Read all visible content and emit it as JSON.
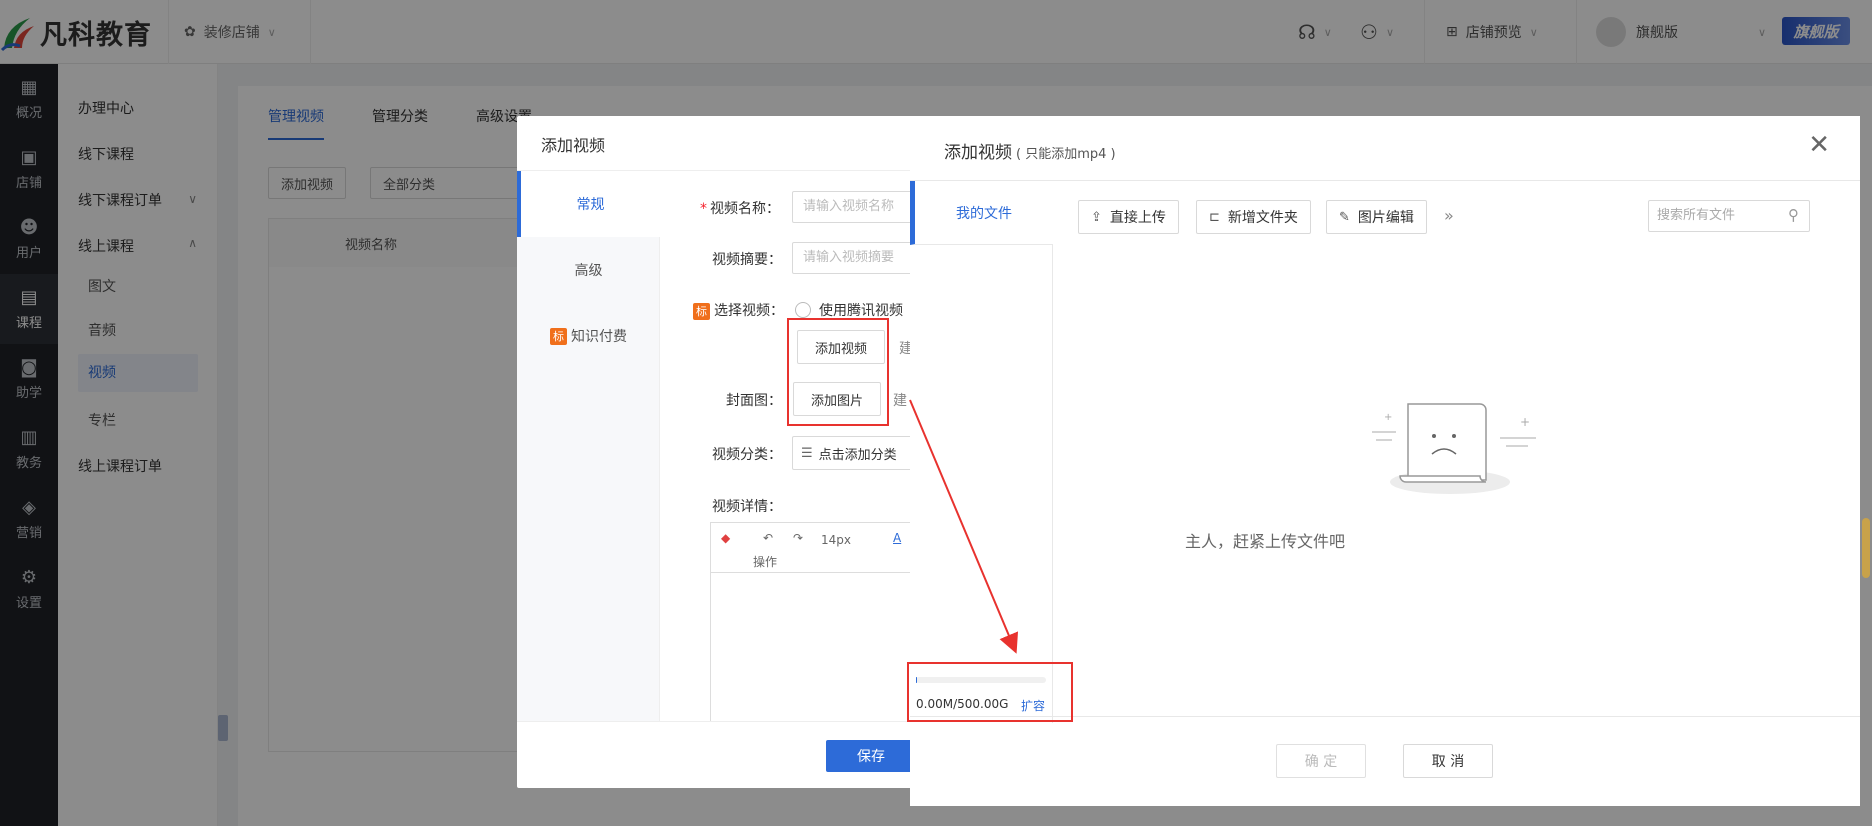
{
  "brand": {
    "name": "凡科教育",
    "accent": "#2d6bd8"
  },
  "header": {
    "shop_switch": "装修店铺",
    "preview": "店铺预览",
    "account": "旗舰版",
    "vip": "旗舰版"
  },
  "icon_nav": [
    {
      "label": "概况",
      "icon": "chart-icon"
    },
    {
      "label": "店铺",
      "icon": "store-icon"
    },
    {
      "label": "用户",
      "icon": "users-icon"
    },
    {
      "label": "课程",
      "icon": "course-icon",
      "active": true
    },
    {
      "label": "助学",
      "icon": "gamepad-icon"
    },
    {
      "label": "教务",
      "icon": "calendar-icon"
    },
    {
      "label": "营销",
      "icon": "tag-icon"
    },
    {
      "label": "设置",
      "icon": "gear-icon"
    }
  ],
  "sub_nav": {
    "items": [
      "办理中心",
      "线下课程",
      "线下课程订单",
      "线上课程",
      "图文",
      "音频",
      "视频",
      "专栏",
      "线上课程订单"
    ]
  },
  "main": {
    "tabs": [
      "管理视频",
      "管理分类",
      "高级设置"
    ],
    "add_btn": "添加视频",
    "category_select": "全部分类",
    "col_name": "视频名称"
  },
  "mid_dialog": {
    "title": "添加视频",
    "nav": [
      "常规",
      "高级",
      "知识付费"
    ],
    "badge": "标",
    "fields": {
      "name_label": "视频名称：",
      "name_placeholder": "请输入视频名称",
      "summary_label": "视频摘要：",
      "summary_placeholder": "请输入视频摘要",
      "select_label": "选择视频：",
      "radio_tencent": "使用腾讯视频",
      "add_video": "添加视频",
      "hint1": "建",
      "cover_label": "封面图：",
      "add_image": "添加图片",
      "hint2": "建",
      "category_label": "视频分类：",
      "category_btn": "点击添加分类",
      "detail_label": "视频详情：",
      "font_size": "14px",
      "op_label": "操作",
      "font_color": "A"
    },
    "save": "保存"
  },
  "file_dialog": {
    "title": "添加视频",
    "subtitle": "( 只能添加mp4 )",
    "side_tab": "我的文件",
    "upload": "直接上传",
    "new_folder": "新增文件夹",
    "image_edit": "图片编辑",
    "search_placeholder": "搜索所有文件",
    "empty_text": "主人，赶紧上传文件吧",
    "quota_text": "0.00M/500.00G",
    "quota_used_fraction": 0.01,
    "expand": "扩容",
    "ok": "确 定",
    "cancel": "取 消"
  }
}
